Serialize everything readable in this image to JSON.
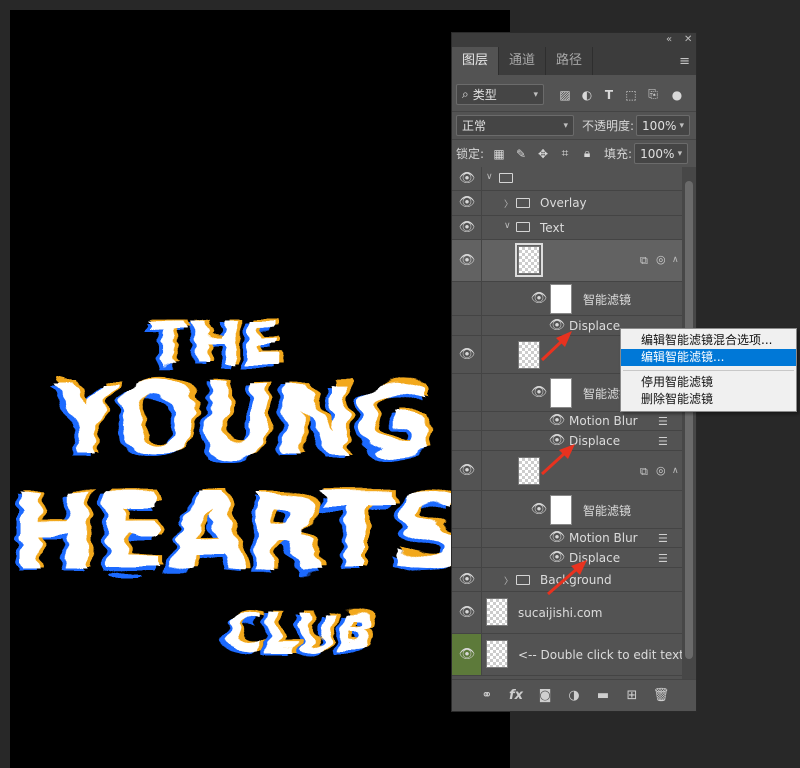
{
  "panel": {
    "tabs": [
      "图层",
      "通道",
      "路径"
    ],
    "filter_kind": "类型",
    "blend_mode": "正常",
    "opacity_label": "不透明度:",
    "opacity_value": "100%",
    "lock_label": "锁定:",
    "fill_label": "填充:",
    "fill_value": "100%"
  },
  "layers": {
    "overlay": "Overlay",
    "text_group": "Text",
    "smart_filters": "智能滤镜",
    "displace": "Displace",
    "motion_blur": "Motion Blur",
    "background": "Background",
    "site": "sucaijishi.com",
    "edit_hint": "<-- Double click to edit text."
  },
  "context_menu": {
    "items": [
      "编辑智能滤镜混合选项...",
      "编辑智能滤镜...",
      "停用智能滤镜",
      "删除智能滤镜"
    ],
    "highlighted": 1
  },
  "artwork": {
    "lines": [
      "THE",
      "YOUNG",
      "HEARTS",
      "CLUB"
    ]
  },
  "colors": {
    "canvas_bg": "#000000",
    "panel_bg": "#535353",
    "selection": "#0078d7",
    "arrow": "#e8321f",
    "text_layer_marker": "#5d7a3a"
  }
}
